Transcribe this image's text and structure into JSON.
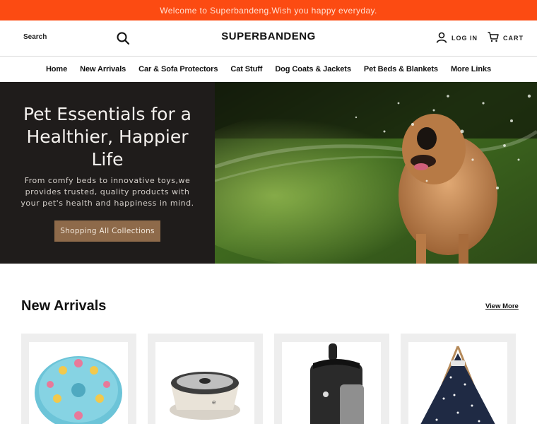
{
  "announcement": "Welcome to Superbandeng.Wish you happy everyday.",
  "header": {
    "search_label": "Search",
    "logo": "SUPERBANDENG",
    "login_label": "LOG IN",
    "cart_label": "CART"
  },
  "nav": {
    "items": [
      {
        "label": "Home"
      },
      {
        "label": "New Arrivals"
      },
      {
        "label": "Car & Sofa Protectors"
      },
      {
        "label": "Cat Stuff"
      },
      {
        "label": "Dog Coats & Jackets"
      },
      {
        "label": "Pet Beds & Blankets"
      },
      {
        "label": "More Links"
      }
    ]
  },
  "hero": {
    "title": "Pet Essentials for a Healthier, Happier Life",
    "subtitle": "From comfy beds to innovative toys,we provides trusted, quality products with your pet's health and happiness in mind.",
    "cta": "Shopping All Collections"
  },
  "new_arrivals": {
    "title": "New Arrivals",
    "view_more": "View More",
    "products": [
      {
        "icon": "puzzle-feeder-image"
      },
      {
        "icon": "water-bowl-image"
      },
      {
        "icon": "treat-pouch-image"
      },
      {
        "icon": "pet-teepee-image"
      }
    ]
  },
  "colors": {
    "announcement_bg": "#fc4b12",
    "hero_bg": "#1f1c1b",
    "cta_bg": "#8e6a4a",
    "card_bg": "#eeeeee"
  }
}
